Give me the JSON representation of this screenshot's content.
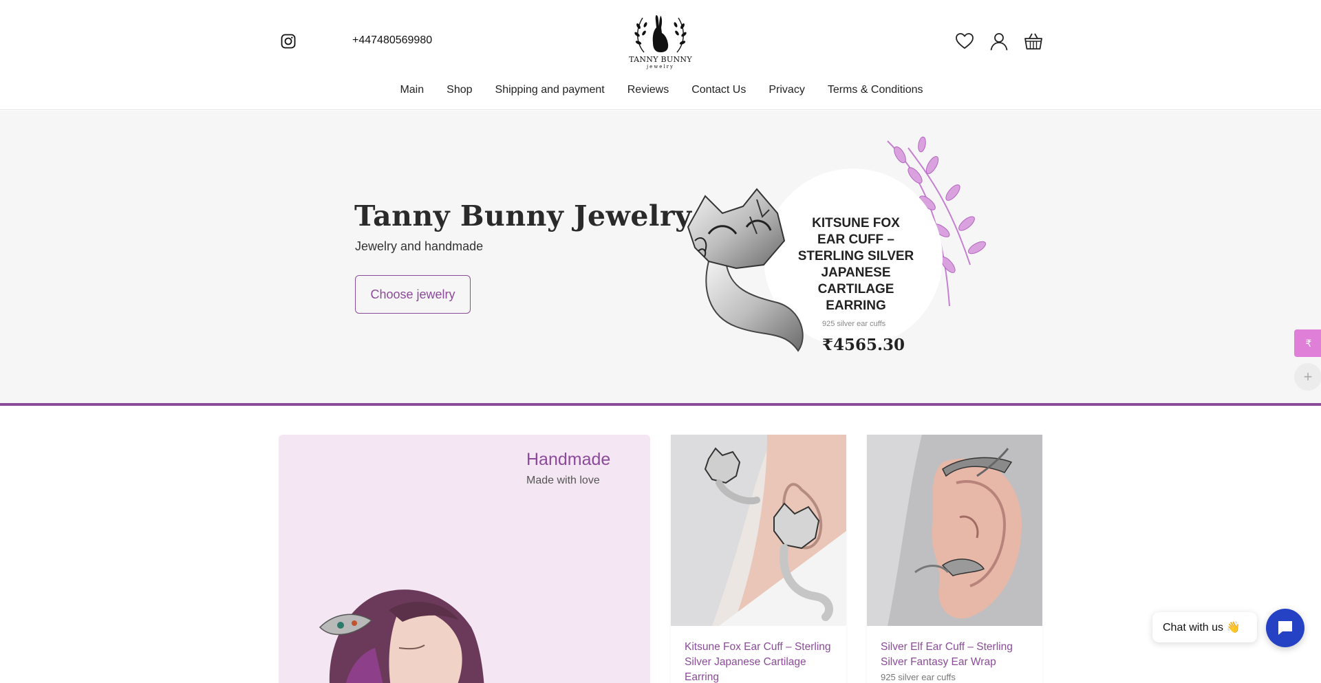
{
  "header": {
    "phone": "+447480569980",
    "logo_line1": "TANNY BUNNY",
    "logo_line2": "jewelry",
    "icons": [
      "instagram-icon",
      "heart-icon",
      "user-icon",
      "basket-icon"
    ]
  },
  "nav": {
    "items": [
      {
        "label": "Main"
      },
      {
        "label": "Shop"
      },
      {
        "label": "Shipping and payment"
      },
      {
        "label": "Reviews"
      },
      {
        "label": "Contact Us"
      },
      {
        "label": "Privacy"
      },
      {
        "label": "Terms & Conditions"
      }
    ]
  },
  "hero": {
    "title": "Tanny Bunny Jewelry",
    "subtitle": "Jewelry and handmade",
    "button_label": "Choose jewelry",
    "product": {
      "title": "KITSUNE FOX EAR CUFF – STERLING SILVER JAPANESE CARTILAGE EARRING",
      "category": "925 silver ear cuffs",
      "price": "₹4565.30"
    }
  },
  "side": {
    "currency_symbol": "₹",
    "plus_symbol": "+"
  },
  "handmade": {
    "title": "Handmade",
    "subtitle": "Made with love"
  },
  "products": [
    {
      "name": "Kitsune Fox Ear Cuff – Sterling Silver Japanese Cartilage Earring",
      "category": ""
    },
    {
      "name": "Silver Elf Ear Cuff – Sterling Silver Fantasy Ear Wrap",
      "category": "925 silver ear cuffs"
    }
  ],
  "chat": {
    "label": "Chat with us 👋"
  },
  "colors": {
    "accent": "#8c4a9a",
    "chat": "#2541c4",
    "currency": "#e07fd8"
  }
}
